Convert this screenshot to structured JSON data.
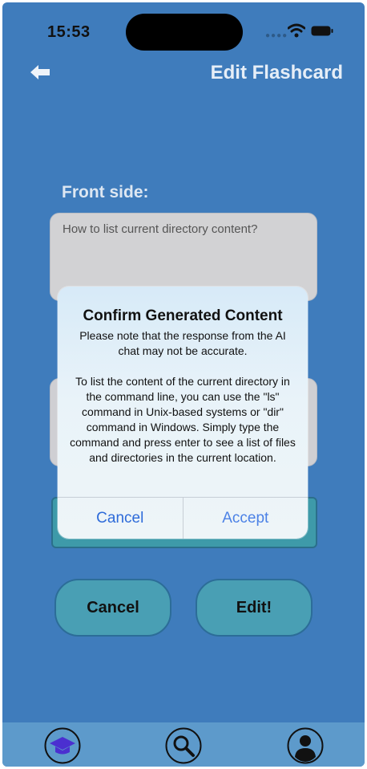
{
  "status_bar": {
    "time": "15:53"
  },
  "header": {
    "title": "Edit Flashcard"
  },
  "form": {
    "front_label": "Front side:",
    "front_value": "How to list current directory content?"
  },
  "buttons": {
    "cancel": "Cancel",
    "edit": "Edit!"
  },
  "dialog": {
    "title": "Confirm Generated Content",
    "message": "Please note that the response from the AI chat may not be accurate.\n\nTo list the content of the current directory in the command line, you can use the \"ls\" command in Unix-based systems or \"dir\" command in Windows. Simply type the command and press enter to see a list of files and directories in the current location.",
    "cancel": "Cancel",
    "accept": "Accept"
  },
  "tabbar": {
    "items": [
      {
        "icon": "graduation-cap-icon"
      },
      {
        "icon": "search-icon"
      },
      {
        "icon": "profile-icon"
      }
    ]
  },
  "colors": {
    "background": "#3f7cbc",
    "button": "#499fb4",
    "dialog_action": "#3478f6",
    "home_icon": "#4b2fd0"
  }
}
